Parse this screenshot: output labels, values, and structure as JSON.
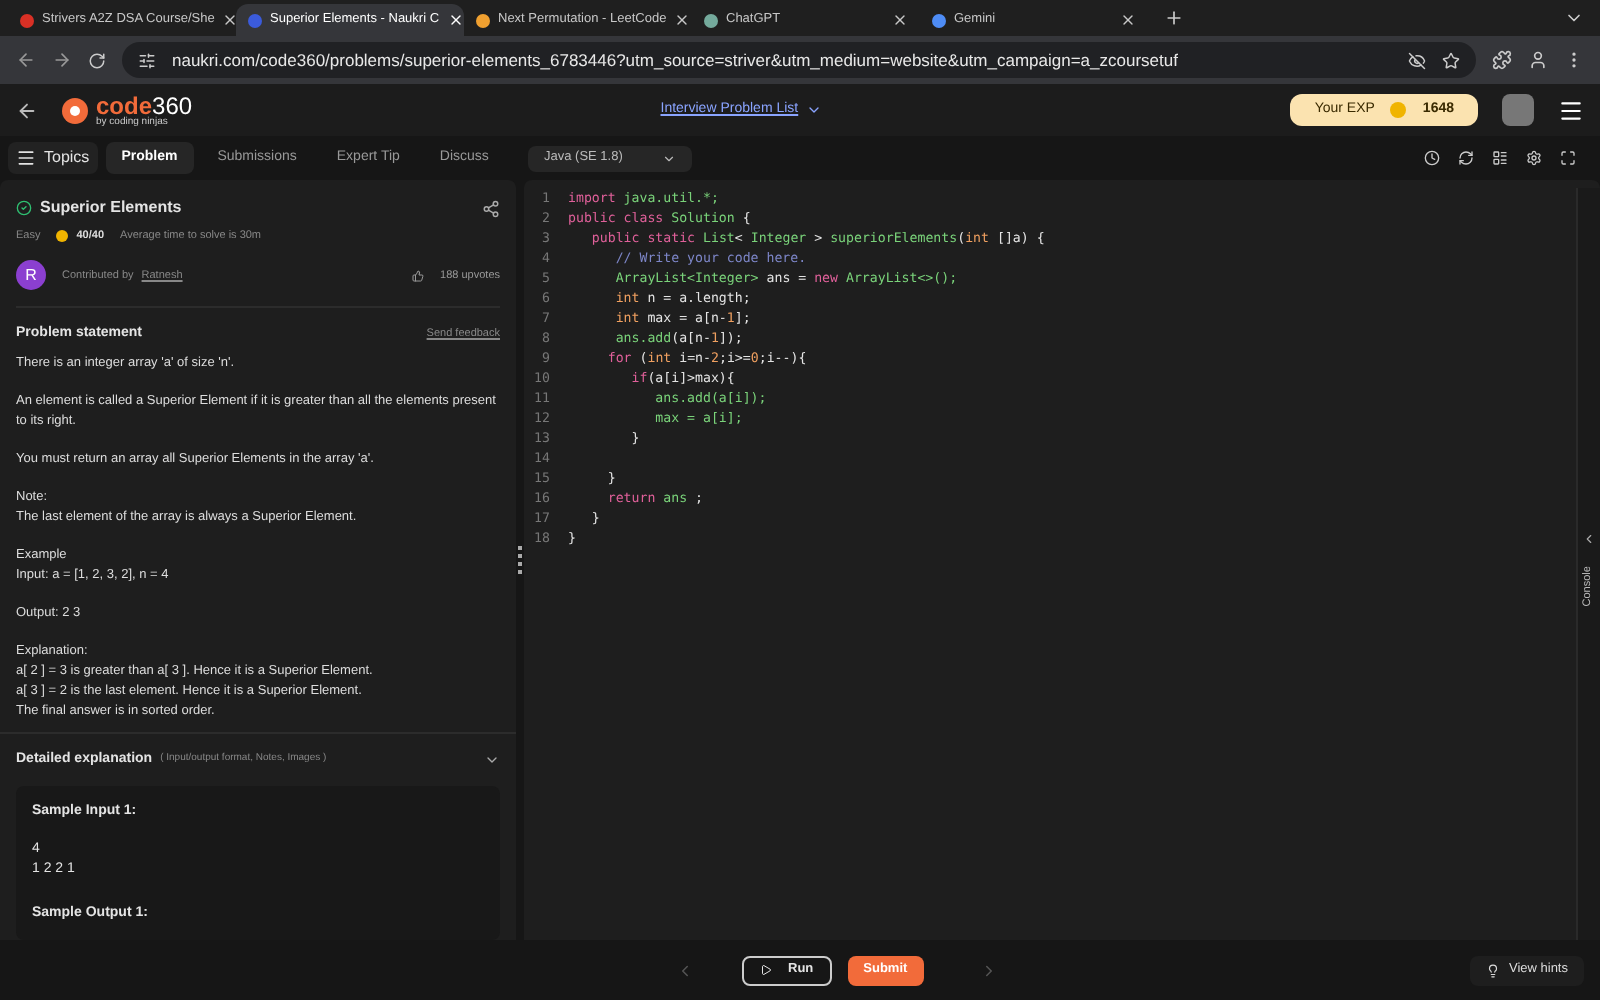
{
  "browser": {
    "tabs": [
      {
        "title": "Strivers A2Z DSA Course/She",
        "selected": false,
        "color": "#d93025"
      },
      {
        "title": "Superior Elements - Naukri C",
        "selected": true,
        "color": "#3b5bdb"
      },
      {
        "title": "Next Permutation - LeetCode",
        "selected": false,
        "color": "#f0a030"
      },
      {
        "title": "ChatGPT",
        "selected": false,
        "color": "#74aa9c"
      },
      {
        "title": "Gemini",
        "selected": false,
        "color": "#4e8cf5"
      }
    ],
    "url": "naukri.com/code360/problems/superior-elements_6783446?utm_source=striver&utm_medium=website&utm_campaign=a_zcoursetuf"
  },
  "header": {
    "logo_main": "code",
    "logo_num": "360",
    "logo_sub": "by coding ninjas",
    "link": "Interview Problem List",
    "exp_label": "Your EXP",
    "exp_value": "1648"
  },
  "nav": {
    "topics": "Topics",
    "tabs": [
      {
        "label": "Problem",
        "selected": true
      },
      {
        "label": "Submissions",
        "selected": false
      },
      {
        "label": "Expert Tip",
        "selected": false
      },
      {
        "label": "Discuss",
        "selected": false
      }
    ],
    "language": "Java (SE 1.8)"
  },
  "problem": {
    "title": "Superior Elements",
    "solved": true,
    "difficulty": "Easy",
    "score": "40/40",
    "avg_time": "Average time to solve is 30m",
    "avatar_letter": "R",
    "contributed_by": "Contributed by",
    "author": "Ratnesh",
    "upvotes": "188 upvotes",
    "statement_title": "Problem statement",
    "feedback": "Send feedback",
    "paragraphs": [
      "There is an integer array 'a' of size 'n'.",
      "An element is called a Superior Element if it is greater than all the elements present to its right.",
      "You must return an array all Superior Elements in the array 'a'.",
      "Note:\nThe last element of the array is always a Superior Element.",
      "Example\nInput: a = [1, 2, 3, 2], n = 4",
      "Output: 2 3",
      "Explanation:\na[ 2 ] = 3 is greater than a[ 3 ]. Hence it is a Superior Element.\na[ 3 ] = 2 is the last element. Hence it is a Superior Element.\nThe final answer is in sorted order."
    ],
    "detail_title": "Detailed explanation",
    "detail_hint": "( Input/output format, Notes, Images )",
    "expanded": false,
    "sample_input_title": "Sample Input 1:",
    "sample_input": "4\n1 2 2 1",
    "sample_output_title": "Sample Output 1:"
  },
  "code": [
    {
      "number": "1",
      "tokens": [
        {
          "kind": "kw",
          "text": "import "
        },
        {
          "kind": "type",
          "text": "java.util.*;"
        }
      ]
    },
    {
      "number": "2",
      "tokens": [
        {
          "kind": "kw",
          "text": "public class "
        },
        {
          "kind": "type",
          "text": "Solution"
        },
        {
          "kind": "plain",
          "text": " {"
        }
      ]
    },
    {
      "number": "3",
      "tokens": [
        {
          "kind": "kw",
          "text": "   public static "
        },
        {
          "kind": "type",
          "text": "List"
        },
        {
          "kind": "plain",
          "text": "< "
        },
        {
          "kind": "type",
          "text": "Integer"
        },
        {
          "kind": "plain",
          "text": " > "
        },
        {
          "kind": "type",
          "text": "superiorElements"
        },
        {
          "kind": "plain",
          "text": "("
        },
        {
          "kind": "num",
          "text": "int"
        },
        {
          "kind": "plain",
          "text": " []a) {"
        }
      ]
    },
    {
      "number": "4",
      "tokens": [
        {
          "kind": "comment",
          "text": "      // Write your code here."
        }
      ]
    },
    {
      "number": "5",
      "tokens": [
        {
          "kind": "type",
          "text": "      ArrayList<Integer>"
        },
        {
          "kind": "plain",
          "text": " ans = "
        },
        {
          "kind": "kw",
          "text": "new "
        },
        {
          "kind": "type",
          "text": "ArrayList<>();"
        }
      ]
    },
    {
      "number": "6",
      "tokens": [
        {
          "kind": "num",
          "text": "      int "
        },
        {
          "kind": "plain",
          "text": "n = a.length;"
        }
      ]
    },
    {
      "number": "7",
      "tokens": [
        {
          "kind": "num",
          "text": "      int "
        },
        {
          "kind": "plain",
          "text": "max = a[n-"
        },
        {
          "kind": "num",
          "text": "1"
        },
        {
          "kind": "plain",
          "text": "];"
        }
      ]
    },
    {
      "number": "8",
      "tokens": [
        {
          "kind": "type",
          "text": "      ans.add"
        },
        {
          "kind": "plain",
          "text": "(a[n-"
        },
        {
          "kind": "num",
          "text": "1"
        },
        {
          "kind": "plain",
          "text": "]);"
        }
      ]
    },
    {
      "number": "9",
      "tokens": [
        {
          "kind": "kw",
          "text": "     for "
        },
        {
          "kind": "plain",
          "text": "("
        },
        {
          "kind": "num",
          "text": "int "
        },
        {
          "kind": "plain",
          "text": "i=n-"
        },
        {
          "kind": "num",
          "text": "2"
        },
        {
          "kind": "plain",
          "text": ";i>="
        },
        {
          "kind": "num",
          "text": "0"
        },
        {
          "kind": "plain",
          "text": ";i--){"
        }
      ]
    },
    {
      "number": "10",
      "tokens": [
        {
          "kind": "kw",
          "text": "        if"
        },
        {
          "kind": "plain",
          "text": "(a[i]>max){"
        }
      ]
    },
    {
      "number": "11",
      "tokens": [
        {
          "kind": "type",
          "text": "           ans.add(a[i]);"
        }
      ]
    },
    {
      "number": "12",
      "tokens": [
        {
          "kind": "type",
          "text": "           max = a[i];"
        }
      ]
    },
    {
      "number": "13",
      "tokens": [
        {
          "kind": "plain",
          "text": "        }"
        }
      ]
    },
    {
      "number": "14"
    },
    {
      "number": "15",
      "tokens": [
        {
          "kind": "plain",
          "text": "     }"
        }
      ]
    },
    {
      "number": "16",
      "tokens": [
        {
          "kind": "kw",
          "text": "     return "
        },
        {
          "kind": "type",
          "text": "ans"
        },
        {
          "kind": "plain",
          "text": " ;"
        }
      ]
    },
    {
      "number": "17",
      "tokens": [
        {
          "kind": "plain",
          "text": "   }"
        }
      ]
    },
    {
      "number": "18",
      "tokens": [
        {
          "kind": "plain",
          "text": "}"
        }
      ]
    }
  ],
  "console_label": "Console",
  "footer": {
    "run": "Run",
    "submit": "Submit",
    "hints": "View hints"
  }
}
